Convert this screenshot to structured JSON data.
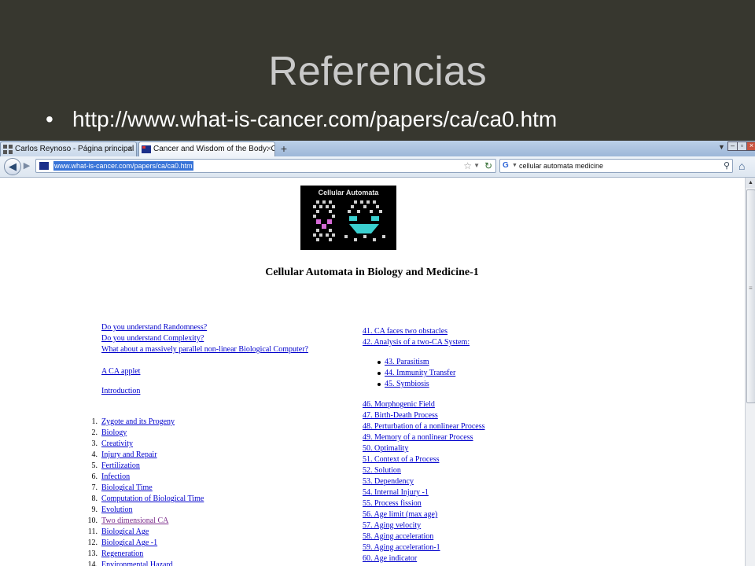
{
  "slide": {
    "title": "Referencias",
    "bullet_url": "http://www.what-is-cancer.com/papers/ca/ca0.htm"
  },
  "browser": {
    "tabs": [
      {
        "label": "Carlos Reynoso - Página principal",
        "active": false
      },
      {
        "label": "Cancer and Wisdom of the Body: Cell...",
        "active": true
      }
    ],
    "new_tab_symbol": "+",
    "url": "www.what-is-cancer.com/papers/ca/ca0.htm",
    "search_value": "cellular automata medicine",
    "icons": [
      "back-icon",
      "forward-icon",
      "star-icon",
      "reload-icon",
      "google-icon",
      "search-icon",
      "home-icon"
    ]
  },
  "page": {
    "logo_text": "Cellular Automata",
    "heading": "Cellular Automata in Biology and Medicine-1",
    "intro_links": [
      "Do you understand Randomness?",
      "Do you understand Complexity?",
      "What about a massively parallel non-linear Biological Computer?"
    ],
    "applet_link": "A CA applet",
    "introduction_link": "Introduction",
    "numbered_items": [
      {
        "n": "1.",
        "label": "Zygote and its Progeny",
        "visited": false
      },
      {
        "n": "2.",
        "label": "Biology",
        "visited": false
      },
      {
        "n": "3.",
        "label": "Creativity",
        "visited": false
      },
      {
        "n": "4.",
        "label": "Injury and Repair",
        "visited": false
      },
      {
        "n": "5.",
        "label": "Fertilization",
        "visited": false
      },
      {
        "n": "6.",
        "label": "Infection",
        "visited": false
      },
      {
        "n": "7.",
        "label": "Biological Time",
        "visited": false
      },
      {
        "n": "8.",
        "label": "Computation of Biological Time",
        "visited": false
      },
      {
        "n": "9.",
        "label": "Evolution",
        "visited": false
      },
      {
        "n": "10.",
        "label": "Two dimensional CA",
        "visited": true
      },
      {
        "n": "11.",
        "label": "Biological Age",
        "visited": false
      },
      {
        "n": "12.",
        "label": "Biological Age -1",
        "visited": false
      },
      {
        "n": "13.",
        "label": "Regeneration",
        "visited": false
      },
      {
        "n": "14.",
        "label": "Environmental Hazard",
        "visited": false
      }
    ],
    "right_top_links": [
      "41. CA faces two obstacles",
      "42. Analysis of a two-CA System:"
    ],
    "right_sub_links": [
      "43. Parasitism",
      "44. Immunity Transfer",
      "45. Symbiosis"
    ],
    "right_links": [
      "46. Morphogenic Field",
      "47. Birth-Death Process",
      "48. Perturbation of a nonlinear Process",
      "49. Memory of a nonlinear Process",
      "50. Optimality",
      "51. Context of a Process",
      "52. Solution",
      "53. Dependency",
      "54. Internal Injury -1",
      "55. Process fission",
      "56. Age limit (max age)",
      "57. Aging velocity",
      "58. Aging acceleration",
      "59. Aging acceleration-1",
      "60. Age indicator"
    ]
  }
}
